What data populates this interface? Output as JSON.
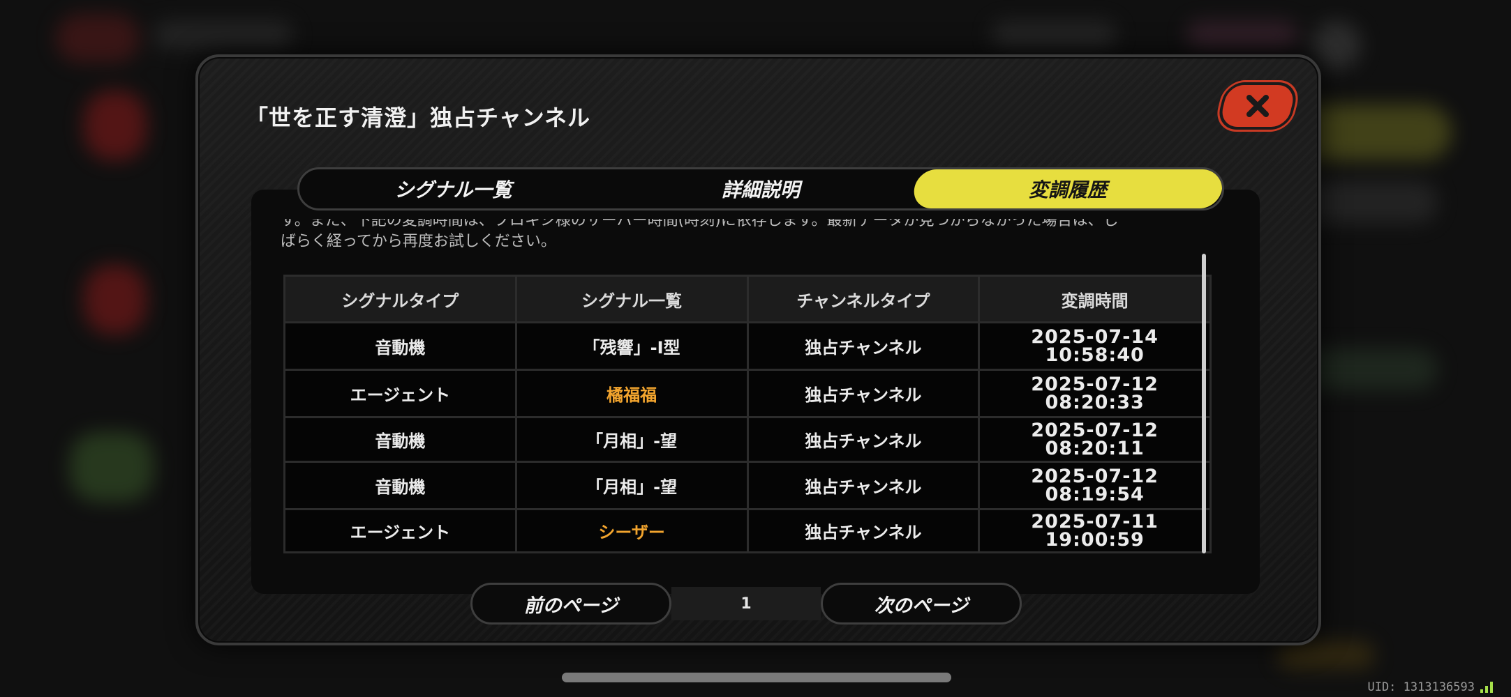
{
  "modal": {
    "title": "「世を正す清澄」独占チャンネル"
  },
  "tabs": [
    {
      "label": "シグナル一覧",
      "active": false
    },
    {
      "label": "詳細説明",
      "active": false
    },
    {
      "label": "変調履歴",
      "active": true
    }
  ],
  "description": {
    "line1": "す。また、下記の変調時間は、プロキシ様のサーバー時間(時刻)に依存します。最新データが見つからなかった場合は、し",
    "line2": "ばらく経ってから再度お試しください。"
  },
  "table": {
    "headers": [
      "シグナルタイプ",
      "シグナル一覧",
      "チャンネルタイプ",
      "変調時間"
    ],
    "rows": [
      {
        "type": "音動機",
        "signal": "「残響」-Ⅰ型",
        "channel": "独占チャンネル",
        "time_date": "2025-07-14",
        "time_clock": "10:58:40",
        "highlight": false
      },
      {
        "type": "エージェント",
        "signal": "橘福福",
        "channel": "独占チャンネル",
        "time_date": "2025-07-12",
        "time_clock": "08:20:33",
        "highlight": true
      },
      {
        "type": "音動機",
        "signal": "「月相」-望",
        "channel": "独占チャンネル",
        "time_date": "2025-07-12 08:20:11",
        "time_clock": "",
        "highlight": false
      },
      {
        "type": "音動機",
        "signal": "「月相」-望",
        "channel": "独占チャンネル",
        "time_date": "2025-07-12",
        "time_clock": "08:19:54",
        "highlight": false
      },
      {
        "type": "エージェント",
        "signal": "シーザー",
        "channel": "独占チャンネル",
        "time_date": "2025-07-11 19:00:59",
        "time_clock": "",
        "highlight": true
      }
    ]
  },
  "pager": {
    "prev_label": "前のページ",
    "page": "1",
    "next_label": "次のページ"
  },
  "footer": {
    "uid": "UID: 1313136593"
  },
  "colors": {
    "accent_yellow": "#e7de3f",
    "highlight_orange": "#f3a52e",
    "close_red": "#d23a22"
  },
  "icons": [
    "close-icon",
    "signal-strength-icon"
  ]
}
